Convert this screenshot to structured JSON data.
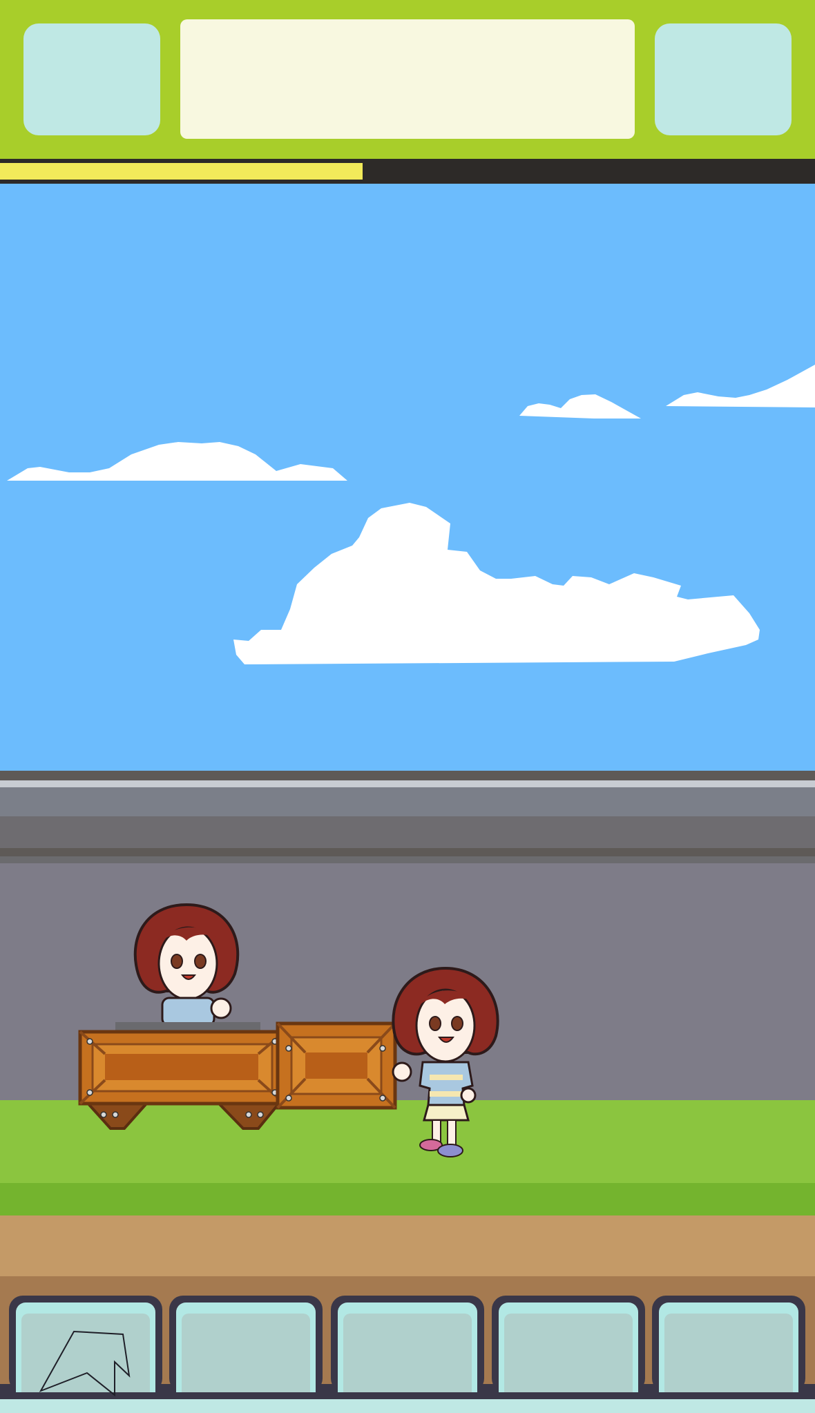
{
  "hud": {
    "progress_fraction": 0.445,
    "colors": {
      "bar": "#a8ce2a",
      "progress_fill": "#f2ea5a",
      "progress_track": "#2d2a28",
      "button": "#bfe8e4",
      "title_panel": "#f8f8e0"
    }
  },
  "scene": {
    "sky_color": "#6cbcfd",
    "characters": [
      {
        "name": "girl-behind-crate",
        "pose": "waving"
      },
      {
        "name": "girl-standing",
        "pose": "waving"
      }
    ],
    "crates": [
      "large-crate-on-stand",
      "small-crate"
    ]
  },
  "toolbar": {
    "slots": [
      {
        "icon": "cursor-arrow-icon"
      },
      {
        "icon": ""
      },
      {
        "icon": ""
      },
      {
        "icon": ""
      },
      {
        "icon": ""
      }
    ]
  }
}
